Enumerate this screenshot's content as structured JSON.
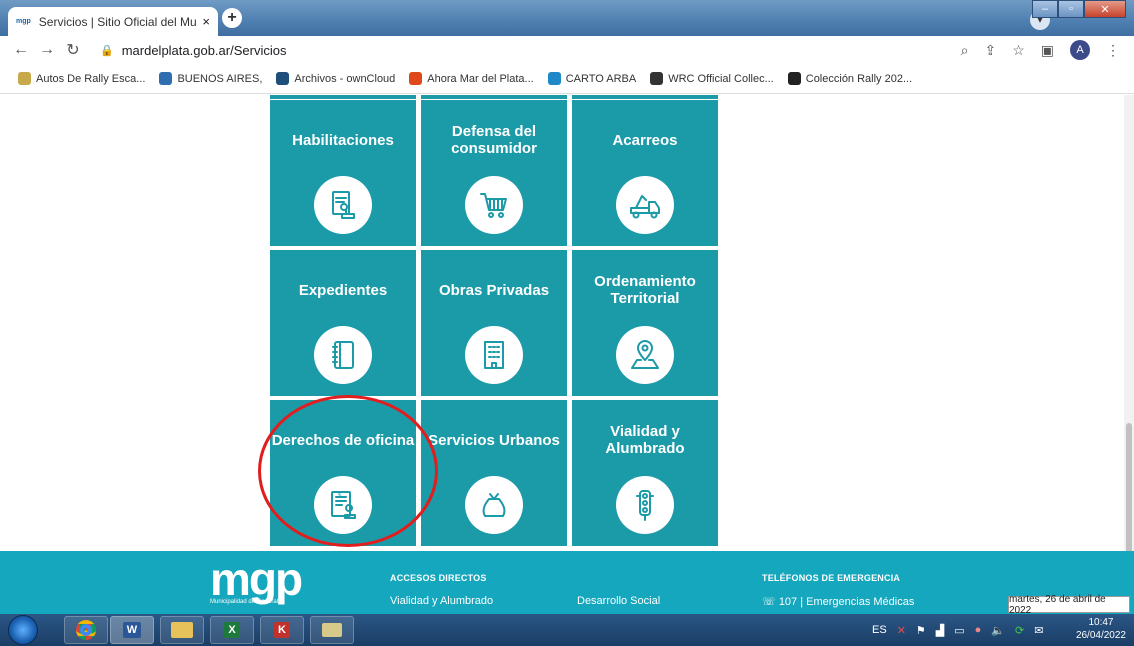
{
  "browser": {
    "tab_title": "Servicios | Sitio Oficial del Munici",
    "tab_favicon": "mgp",
    "close_tab": "×",
    "new_tab": "+",
    "url": "mardelplata.gob.ar/Servicios",
    "avatar": "A",
    "bookmarks": [
      {
        "label": "Autos De Rally Esca...",
        "icon": "rally-icon",
        "color": "#c7a84a"
      },
      {
        "label": "BUENOS AIRES,",
        "icon": "mountain-icon",
        "color": "#2f6fb0"
      },
      {
        "label": "Archivos - ownCloud",
        "icon": "cloud-icon",
        "color": "#1e4f7a"
      },
      {
        "label": "Ahora Mar del Plata...",
        "icon": "refresh-icon",
        "color": "#e0471b"
      },
      {
        "label": "CARTO ARBA",
        "icon": "arba-icon",
        "color": "#1e88c8"
      },
      {
        "label": "WRC Official Collec...",
        "icon": "car-icon",
        "color": "#333333"
      },
      {
        "label": "Colección Rally 202...",
        "icon": "disc-icon",
        "color": "#222222"
      }
    ]
  },
  "tiles": [
    {
      "label": "Habilitaciones",
      "icon": "document-stamp-icon"
    },
    {
      "label": "Defensa del consumidor",
      "icon": "shopping-cart-icon"
    },
    {
      "label": "Acarreos",
      "icon": "tow-truck-icon"
    },
    {
      "label": "Expedientes",
      "icon": "binder-icon"
    },
    {
      "label": "Obras Privadas",
      "icon": "building-icon"
    },
    {
      "label": "Ordenamiento Territorial",
      "icon": "map-pin-icon"
    },
    {
      "label": "Derechos de oficina",
      "icon": "invoice-stamp-icon"
    },
    {
      "label": "Servicios Urbanos",
      "icon": "trash-bag-icon"
    },
    {
      "label": "Vialidad y Alumbrado",
      "icon": "traffic-light-icon"
    }
  ],
  "footer": {
    "logo": "mgp",
    "logo_sub": "Municipalidad de General",
    "accesos_heading": "ACCESOS DIRECTOS",
    "accesos_link1": "Vialidad y Alumbrado",
    "accesos_link2": "Desarrollo Social",
    "telefonos_heading": "TELÉFONOS DE EMERGENCIA",
    "telefonos_link1": "107 | Emergencias Médicas"
  },
  "tooltip": "martes, 26 de abril de 2022",
  "taskbar": {
    "lang": "ES",
    "time": "10:47",
    "date": "26/04/2022"
  },
  "colors": {
    "tile": "#1b9aa8",
    "footer": "#15a7bd",
    "highlight": "#e11d1d"
  }
}
